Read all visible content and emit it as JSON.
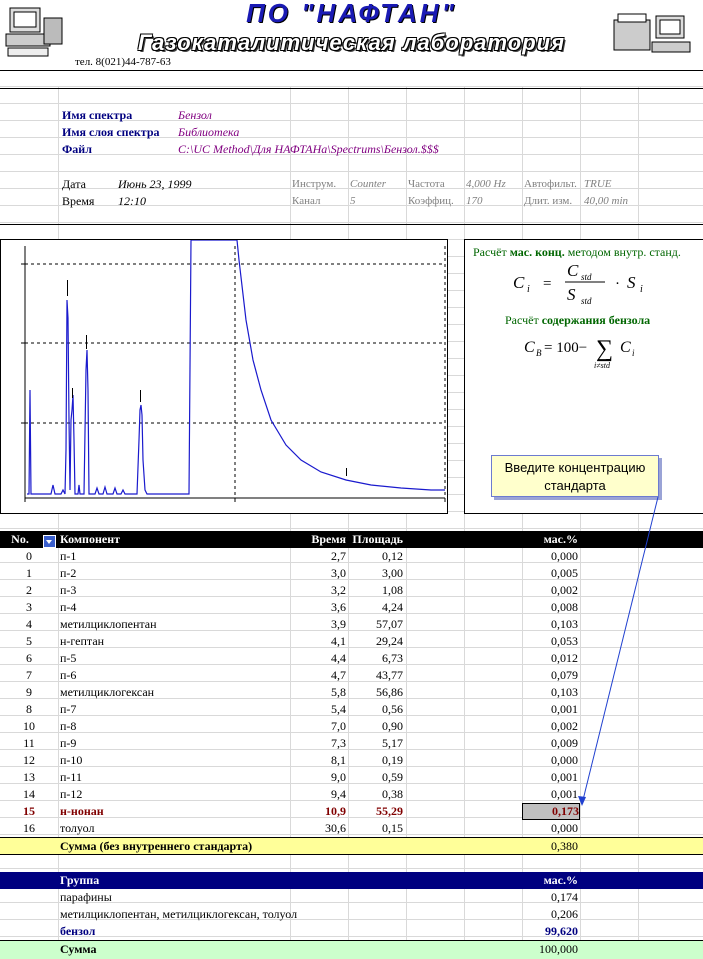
{
  "header": {
    "company": "ПО \"НАФТАН\"",
    "lab": "Газокаталитическая лаборатория",
    "phone": "тел. 8(021)44-787-63"
  },
  "info": {
    "spectrum_name_label": "Имя спектра",
    "spectrum_name": "Бензол",
    "layer_name_label": "Имя слоя спектра",
    "layer_name": "Библиотека",
    "file_label": "Файл",
    "file": "C:\\UC Method\\Для НАФТАНа\\Spectrums\\Бензол.$$$",
    "date_label": "Дата",
    "date": "Июнь 23, 1999",
    "time_label": "Время",
    "time": "12:10",
    "instr_label": "Инструм.",
    "instr": "Counter",
    "freq_label": "Частота",
    "freq": "4,000 Hz",
    "autofilter_label": "Автофильт.",
    "autofilter": "TRUE",
    "channel_label": "Канал",
    "channel": "5",
    "coef_label": "Коэффиц.",
    "coef": "170",
    "duration_label": "Длит. изм.",
    "duration": "40,00 min"
  },
  "formula": {
    "calc1_prefix": "Расчёт ",
    "calc1_bold": "мас. конц.",
    "calc1_suffix": " методом внутр. станд.",
    "calc2_prefix": "Расчёт ",
    "calc2_bold": "содержания бензола"
  },
  "callout": {
    "text": "Введите концентрацию стандарта"
  },
  "table": {
    "headers": {
      "no": "No.",
      "component": "Компонент",
      "time": "Время",
      "area": "Площадь",
      "mass": "мас.%"
    },
    "rows": [
      {
        "no": "0",
        "name": "п-1",
        "time": "2,7",
        "area": "0,12",
        "mass": "0,000"
      },
      {
        "no": "1",
        "name": "п-2",
        "time": "3,0",
        "area": "3,00",
        "mass": "0,005"
      },
      {
        "no": "2",
        "name": "п-3",
        "time": "3,2",
        "area": "1,08",
        "mass": "0,002"
      },
      {
        "no": "3",
        "name": "п-4",
        "time": "3,6",
        "area": "4,24",
        "mass": "0,008"
      },
      {
        "no": "4",
        "name": "метилциклопентан",
        "time": "3,9",
        "area": "57,07",
        "mass": "0,103"
      },
      {
        "no": "5",
        "name": "н-гептан",
        "time": "4,1",
        "area": "29,24",
        "mass": "0,053"
      },
      {
        "no": "6",
        "name": "п-5",
        "time": "4,4",
        "area": "6,73",
        "mass": "0,012"
      },
      {
        "no": "7",
        "name": "п-6",
        "time": "4,7",
        "area": "43,77",
        "mass": "0,079"
      },
      {
        "no": "9",
        "name": "метилциклогексан",
        "time": "5,8",
        "area": "56,86",
        "mass": "0,103"
      },
      {
        "no": "8",
        "name": "п-7",
        "time": "5,4",
        "area": "0,56",
        "mass": "0,001"
      },
      {
        "no": "10",
        "name": "п-8",
        "time": "7,0",
        "area": "0,90",
        "mass": "0,002"
      },
      {
        "no": "11",
        "name": "п-9",
        "time": "7,3",
        "area": "5,17",
        "mass": "0,009"
      },
      {
        "no": "12",
        "name": "п-10",
        "time": "8,1",
        "area": "0,19",
        "mass": "0,000"
      },
      {
        "no": "13",
        "name": "п-11",
        "time": "9,0",
        "area": "0,59",
        "mass": "0,001"
      },
      {
        "no": "14",
        "name": "п-12",
        "time": "9,4",
        "area": "0,38",
        "mass": "0,001"
      },
      {
        "no": "15",
        "name": "н-нонан",
        "time": "10,9",
        "area": "55,29",
        "mass": "0,173"
      },
      {
        "no": "16",
        "name": "толуол",
        "time": "30,6",
        "area": "0,15",
        "mass": "0,000"
      }
    ],
    "sum_label": "Сумма (без внутреннего стандарта)",
    "sum_value": "0,380"
  },
  "groups": {
    "header_label": "Группа",
    "header_mass": "мас.%",
    "rows": [
      {
        "name": "парафины",
        "mass": "0,174"
      },
      {
        "name": "метилциклопентан, метилциклогексан, толуол",
        "mass": "0,206"
      },
      {
        "name": "бензол",
        "mass": "99,620"
      }
    ],
    "total_label": "Сумма",
    "total_value": "100,000"
  },
  "colors": {
    "accent_navy": "#000080",
    "highlight_red": "#800000",
    "trace": "#1a1acd",
    "sum_yellow": "#ffff99",
    "total_green": "#ccffcc"
  }
}
